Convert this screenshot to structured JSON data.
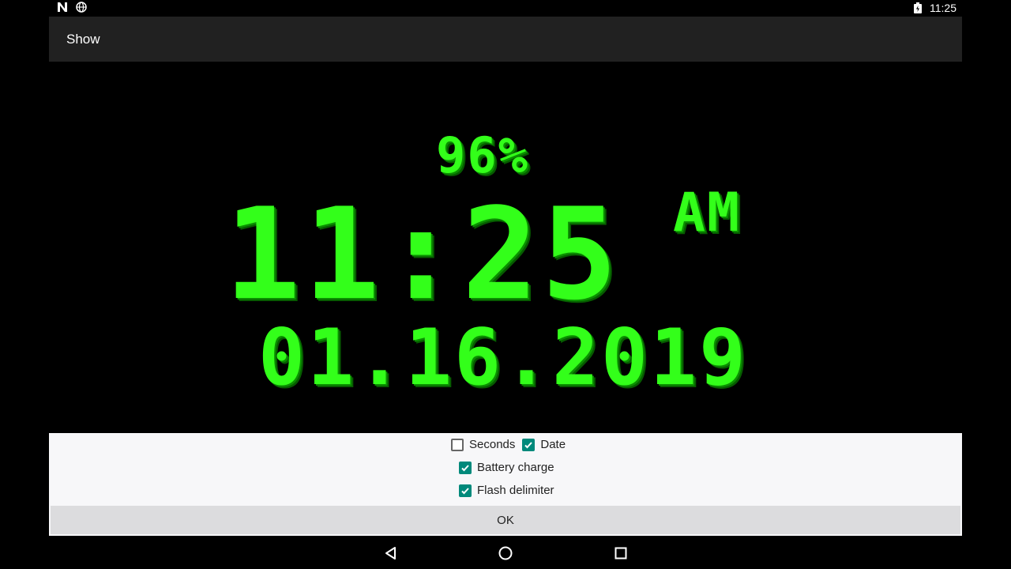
{
  "status_bar": {
    "time": "11:25",
    "icons": [
      "n-icon",
      "globe-icon",
      "battery-charging-icon"
    ]
  },
  "title_bar": {
    "title": "Show"
  },
  "clock": {
    "battery": "96%",
    "time": "11:25",
    "ampm": "AM",
    "date": "01.16.2019",
    "color": "#33ff1a"
  },
  "options": {
    "seconds": {
      "label": "Seconds",
      "checked": false
    },
    "date": {
      "label": "Date",
      "checked": true
    },
    "battery_charge": {
      "label": "Battery charge",
      "checked": true
    },
    "flash_delimiter": {
      "label": "Flash delimiter",
      "checked": true
    },
    "accent": "#00897b"
  },
  "ok_button": {
    "label": "OK"
  },
  "nav_bar": {
    "icons": [
      "back-icon",
      "home-icon",
      "recents-icon"
    ]
  }
}
